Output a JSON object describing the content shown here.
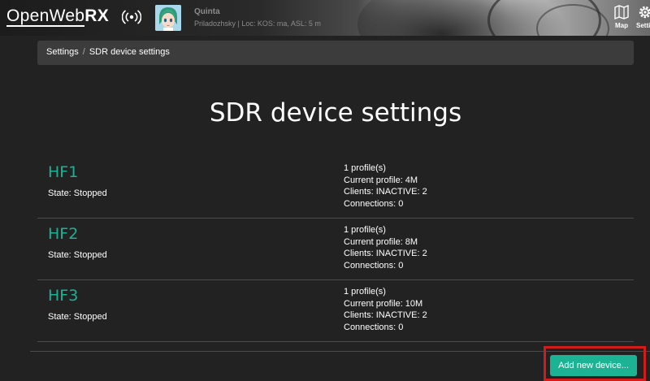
{
  "header": {
    "logo_part1": "OpenWeb",
    "logo_part2": "RX",
    "receiver_name": "Quinta",
    "receiver_desc": "Priladozhsky | Loc: KOS: ma, ASL: 5 m",
    "nav": [
      {
        "label": "Map",
        "icon": "map-icon"
      },
      {
        "label": "Setti",
        "icon": "gear-icon"
      }
    ]
  },
  "breadcrumb": {
    "parent": "Settings",
    "separator": "/",
    "current": "SDR device settings"
  },
  "page": {
    "title": "SDR device settings"
  },
  "devices": [
    {
      "name": "HF1",
      "state": "State: Stopped",
      "profiles": "1 profile(s)",
      "current_profile": "Current profile: 4M",
      "clients": "Clients: INACTIVE: 2",
      "connections": "Connections: 0"
    },
    {
      "name": "HF2",
      "state": "State: Stopped",
      "profiles": "1 profile(s)",
      "current_profile": "Current profile: 8M",
      "clients": "Clients: INACTIVE: 2",
      "connections": "Connections: 0"
    },
    {
      "name": "HF3",
      "state": "State: Stopped",
      "profiles": "1 profile(s)",
      "current_profile": "Current profile: 10M",
      "clients": "Clients: INACTIVE: 2",
      "connections": "Connections: 0"
    }
  ],
  "actions": {
    "add_device_label": "Add new device..."
  },
  "colors": {
    "background": "#222222",
    "accent": "#1cb394",
    "breadcrumb_bg": "#3c3c3c",
    "highlight_frame": "#d11c1c"
  }
}
